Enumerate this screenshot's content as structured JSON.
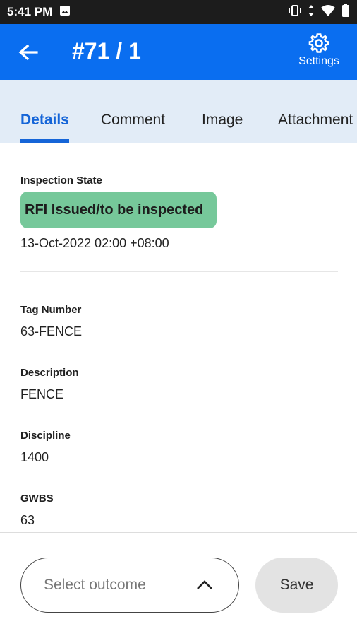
{
  "status_bar": {
    "time": "5:41 PM"
  },
  "app_bar": {
    "title": "#71 / 1",
    "settings_label": "Settings"
  },
  "tabs": [
    {
      "label": "Details",
      "active": true
    },
    {
      "label": "Comment",
      "active": false
    },
    {
      "label": "Image",
      "active": false
    },
    {
      "label": "Attachment",
      "active": false
    }
  ],
  "details": {
    "inspection_state_label": "Inspection State",
    "inspection_state_value": "RFI Issued/to be inspected",
    "inspection_state_color": "#76c89a",
    "inspection_datetime": "13-Oct-2022 02:00  +08:00",
    "fields": [
      {
        "label": "Tag Number",
        "value": "63-FENCE"
      },
      {
        "label": "Description",
        "value": "FENCE"
      },
      {
        "label": "Discipline",
        "value": "1400"
      },
      {
        "label": "GWBS",
        "value": "63"
      }
    ]
  },
  "footer": {
    "outcome_placeholder": "Select outcome",
    "save_label": "Save"
  },
  "colors": {
    "primary": "#0a6ef0",
    "tab_active": "#1565d8",
    "tab_bar_bg": "#e2ecf7"
  }
}
